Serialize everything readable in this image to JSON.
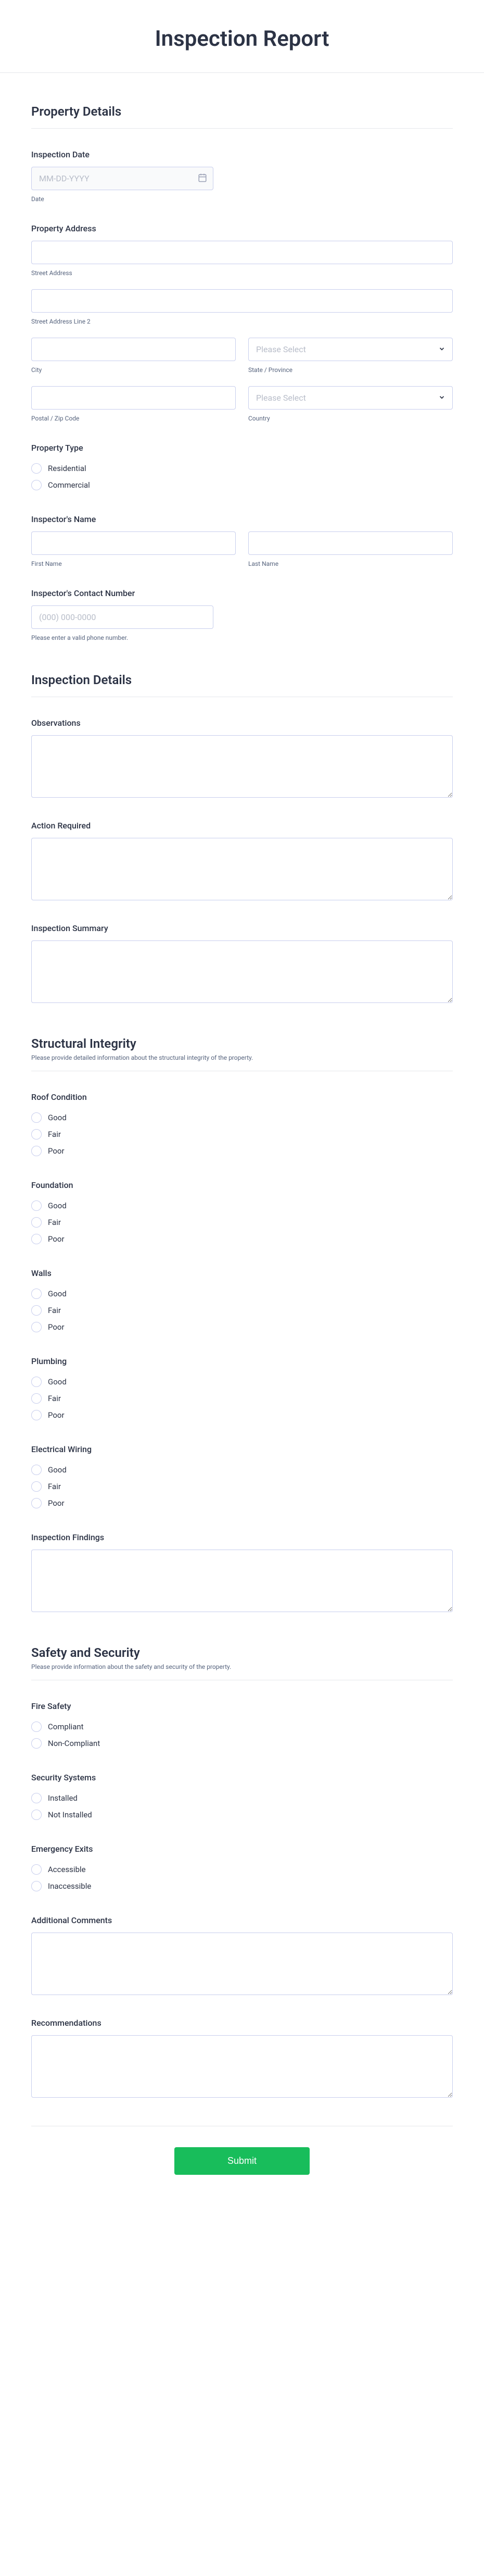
{
  "title": "Inspection Report",
  "sections": {
    "property_details": {
      "title": "Property Details"
    },
    "inspection_details": {
      "title": "Inspection Details"
    },
    "structural": {
      "title": "Structural Integrity",
      "sub": "Please provide detailed information about the structural integrity of the property."
    },
    "safety": {
      "title": "Safety and Security",
      "sub": "Please provide information about the safety and security of the property."
    }
  },
  "fields": {
    "inspection_date": {
      "label": "Inspection Date",
      "placeholder": "MM-DD-YYYY",
      "sublabel": "Date"
    },
    "property_address": {
      "label": "Property Address",
      "street_sub": "Street Address",
      "street2_sub": "Street Address Line 2",
      "city_sub": "City",
      "state_sub": "State / Province",
      "postal_sub": "Postal / Zip Code",
      "country_sub": "Country",
      "select_placeholder": "Please Select"
    },
    "property_type": {
      "label": "Property Type",
      "options": [
        "Residential",
        "Commercial"
      ]
    },
    "inspector_name": {
      "label": "Inspector's Name",
      "first_sub": "First Name",
      "last_sub": "Last Name"
    },
    "inspector_phone": {
      "label": "Inspector's Contact Number",
      "placeholder": "(000) 000-0000",
      "sublabel": "Please enter a valid phone number."
    },
    "observations": {
      "label": "Observations"
    },
    "action_required": {
      "label": "Action Required"
    },
    "inspection_summary": {
      "label": "Inspection Summary"
    },
    "roof": {
      "label": "Roof Condition",
      "options": [
        "Good",
        "Fair",
        "Poor"
      ]
    },
    "foundation": {
      "label": "Foundation",
      "options": [
        "Good",
        "Fair",
        "Poor"
      ]
    },
    "walls": {
      "label": "Walls",
      "options": [
        "Good",
        "Fair",
        "Poor"
      ]
    },
    "plumbing": {
      "label": "Plumbing",
      "options": [
        "Good",
        "Fair",
        "Poor"
      ]
    },
    "electrical": {
      "label": "Electrical Wiring",
      "options": [
        "Good",
        "Fair",
        "Poor"
      ]
    },
    "inspection_findings": {
      "label": "Inspection Findings"
    },
    "fire_safety": {
      "label": "Fire Safety",
      "options": [
        "Compliant",
        "Non-Compliant"
      ]
    },
    "security_systems": {
      "label": "Security Systems",
      "options": [
        "Installed",
        "Not Installed"
      ]
    },
    "emergency_exits": {
      "label": "Emergency Exits",
      "options": [
        "Accessible",
        "Inaccessible"
      ]
    },
    "additional_comments": {
      "label": "Additional Comments"
    },
    "recommendations": {
      "label": "Recommendations"
    }
  },
  "submit": "Submit"
}
